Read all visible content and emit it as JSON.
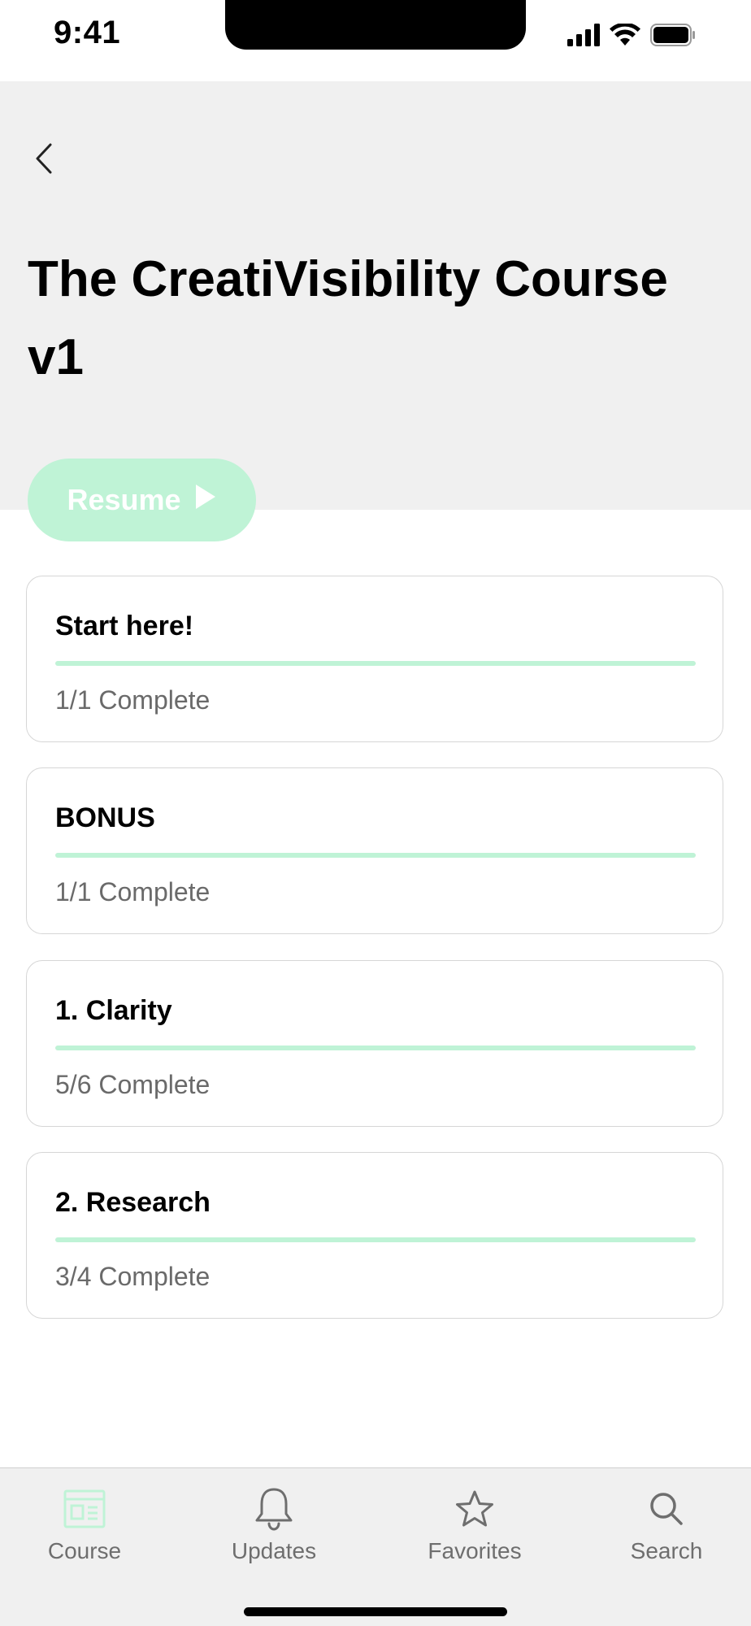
{
  "status_bar": {
    "time": "9:41"
  },
  "header": {
    "title": "The CreatiVisibility Course v1",
    "resume_label": "Resume"
  },
  "modules": [
    {
      "title": "Start here!",
      "status": "1/1 Complete",
      "progress": 1.0
    },
    {
      "title": "BONUS",
      "status": "1/1 Complete",
      "progress": 1.0
    },
    {
      "title": "1. Clarity",
      "status": "5/6 Complete",
      "progress": 1.0
    },
    {
      "title": "2. Research",
      "status": "3/4 Complete",
      "progress": 1.0
    }
  ],
  "tabs": [
    {
      "label": "Course",
      "icon": "course-icon",
      "active": true
    },
    {
      "label": "Updates",
      "icon": "bell-icon",
      "active": false
    },
    {
      "label": "Favorites",
      "icon": "star-icon",
      "active": false
    },
    {
      "label": "Search",
      "icon": "search-icon",
      "active": false
    }
  ],
  "colors": {
    "accent": "#bff3d6",
    "header_bg": "#f0f0f0",
    "muted_text": "#6a6a6a"
  }
}
